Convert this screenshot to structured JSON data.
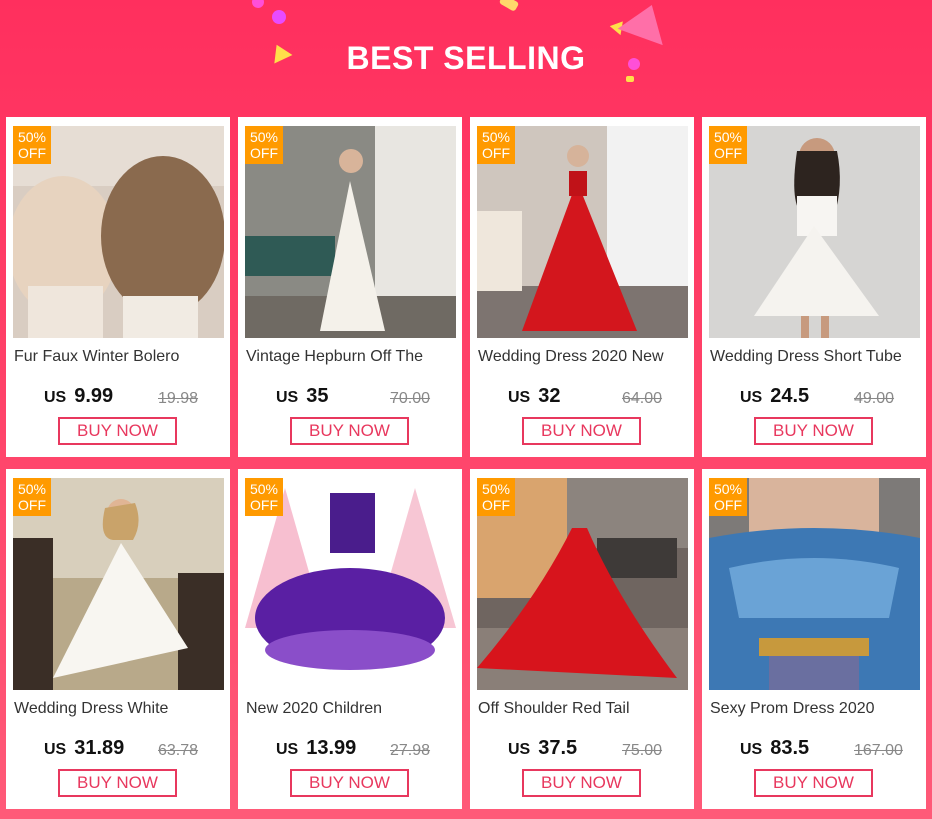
{
  "header": {
    "title": "BEST SELLING"
  },
  "colors": {
    "accent": "#ff2f5e",
    "badge": "#ff9a00",
    "button": "#e8385e"
  },
  "products": [
    {
      "name": "Fur Faux Winter Bolero",
      "currency": "US",
      "price": "9.99",
      "old_price": "19.98",
      "discount": "50%",
      "discount_label": "OFF",
      "button": "BUY NOW"
    },
    {
      "name": "Vintage Hepburn Off The",
      "currency": "US",
      "price": "35",
      "old_price": "70.00",
      "discount": "50%",
      "discount_label": "OFF",
      "button": "BUY NOW"
    },
    {
      "name": "Wedding Dress 2020 New",
      "currency": "US",
      "price": "32",
      "old_price": "64.00",
      "discount": "50%",
      "discount_label": "OFF",
      "button": "BUY NOW"
    },
    {
      "name": "Wedding Dress Short Tube",
      "currency": "US",
      "price": "24.5",
      "old_price": "49.00",
      "discount": "50%",
      "discount_label": "OFF",
      "button": "BUY NOW"
    },
    {
      "name": "Wedding Dress White",
      "currency": "US",
      "price": "31.89",
      "old_price": "63.78",
      "discount": "50%",
      "discount_label": "OFF",
      "button": "BUY NOW"
    },
    {
      "name": "New 2020 Children",
      "currency": "US",
      "price": "13.99",
      "old_price": "27.98",
      "discount": "50%",
      "discount_label": "OFF",
      "button": "BUY NOW"
    },
    {
      "name": "Off Shoulder Red Tail",
      "currency": "US",
      "price": "37.5",
      "old_price": "75.00",
      "discount": "50%",
      "discount_label": "OFF",
      "button": "BUY NOW"
    },
    {
      "name": "Sexy Prom Dress 2020",
      "currency": "US",
      "price": "83.5",
      "old_price": "167.00",
      "discount": "50%",
      "discount_label": "OFF",
      "button": "BUY NOW"
    }
  ]
}
